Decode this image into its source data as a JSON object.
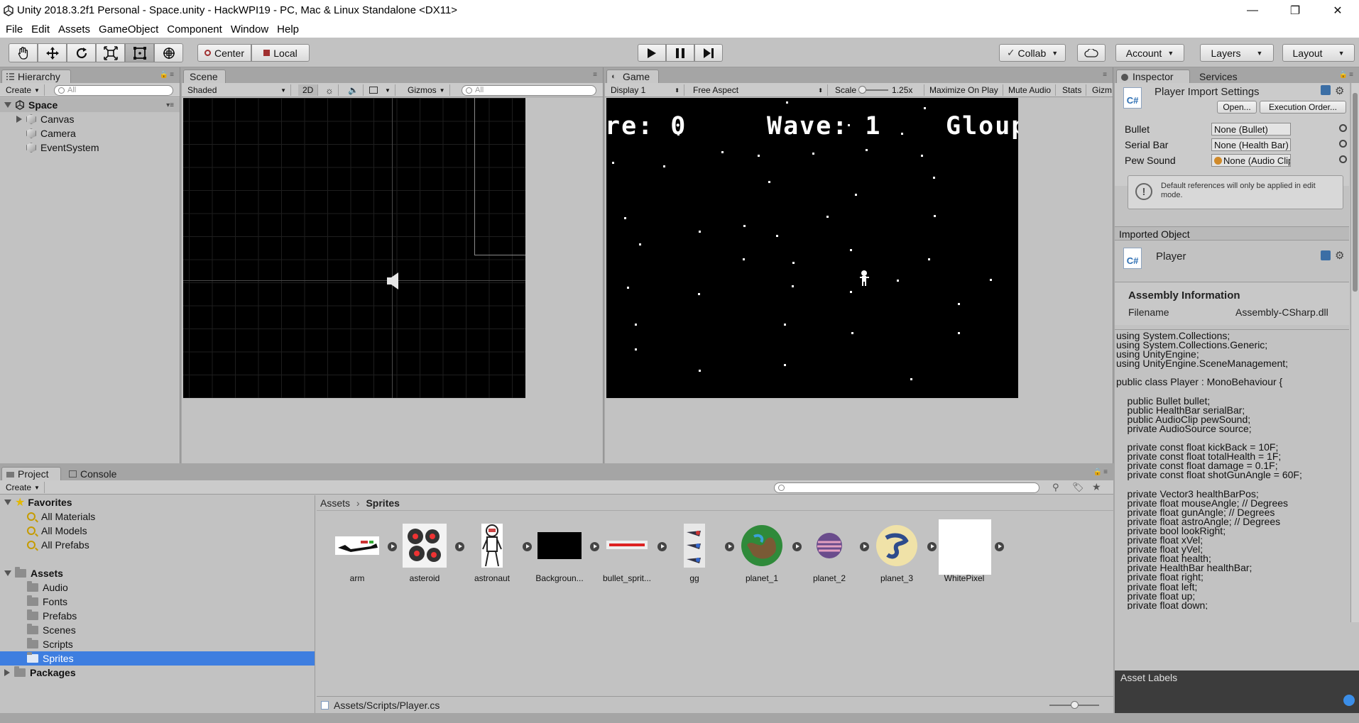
{
  "window": {
    "title": "Unity 2018.3.2f1 Personal - Space.unity - HackWPI19 - PC, Mac & Linux Standalone <DX11>",
    "controls": [
      "—",
      "❐",
      "✕"
    ]
  },
  "menu": [
    "File",
    "Edit",
    "Assets",
    "GameObject",
    "Component",
    "Window",
    "Help"
  ],
  "toolbar": {
    "tools": [
      "hand-tool",
      "move-tool",
      "rotate-tool",
      "scale-tool",
      "rect-tool",
      "transform-tool"
    ],
    "pivot": "Center",
    "space": "Local",
    "collab": "Collab",
    "account": "Account",
    "layers": "Layers",
    "layout": "Layout"
  },
  "hierarchy": {
    "tab": "Hierarchy",
    "create": "Create",
    "search_placeholder": "All",
    "scene": "Space",
    "objects": [
      "Canvas",
      "Camera",
      "EventSystem"
    ]
  },
  "scene": {
    "tab": "Scene",
    "shading": "Shaded",
    "mode_2d": "2D",
    "gizmos": "Gizmos",
    "search_placeholder": "All"
  },
  "game": {
    "tab": "Game",
    "display": "Display 1",
    "aspect": "Free Aspect",
    "scale_label": "Scale",
    "scale_value": "1.25x",
    "maximize": "Maximize On Play",
    "mute": "Mute Audio",
    "stats": "Stats",
    "gizmos": "Gizm",
    "hud_score": "re: 0",
    "hud_wave": "Wave: 1",
    "hud_gloups": "Gloups Left"
  },
  "inspector": {
    "tab": "Inspector",
    "services_tab": "Services",
    "header": "Player Import Settings",
    "open": "Open...",
    "execution_order": "Execution Order...",
    "fields": [
      {
        "label": "Bullet",
        "value": "None (Bullet)"
      },
      {
        "label": "Serial Bar",
        "value": "None (Health Bar)"
      },
      {
        "label": "Pew Sound",
        "value": "None (Audio Clip)"
      }
    ],
    "info": "Default references will only be applied in edit mode.",
    "imported_object": "Imported Object",
    "object_name": "Player",
    "assembly_header": "Assembly Information",
    "filename_label": "Filename",
    "filename_value": "Assembly-CSharp.dll",
    "code": "using System.Collections;\nusing System.Collections.Generic;\nusing UnityEngine;\nusing UnityEngine.SceneManagement;\n\npublic class Player : MonoBehaviour {\n\n    public Bullet bullet;\n    public HealthBar serialBar;\n    public AudioClip pewSound;\n    private AudioSource source;\n\n    private const float kickBack = 10F;\n    private const float totalHealth = 1F;\n    private const float damage = 0.1F;\n    private const float shotGunAngle = 60F;\n\n    private Vector3 healthBarPos;\n    private float mouseAngle; // Degrees\n    private float gunAngle; // Degrees\n    private float astroAngle; // Degrees\n    private bool lookRight;\n    private float xVel;\n    private float yVel;\n    private float health;\n    private HealthBar healthBar;\n    private float right;\n    private float left;\n    private float up;\n    private float down;",
    "asset_labels": "Asset Labels"
  },
  "project": {
    "tab": "Project",
    "console_tab": "Console",
    "create": "Create",
    "favorites_label": "Favorites",
    "favorites": [
      "All Materials",
      "All Models",
      "All Prefabs"
    ],
    "assets_label": "Assets",
    "asset_folders": [
      "Audio",
      "Fonts",
      "Prefabs",
      "Scenes",
      "Scripts",
      "Sprites"
    ],
    "packages_label": "Packages",
    "breadcrumb_root": "Assets",
    "breadcrumb_current": "Sprites",
    "items": [
      "arm",
      "asteroid",
      "astronaut",
      "Backgroun...",
      "bullet_sprit...",
      "gg",
      "planet_1",
      "planet_2",
      "planet_3",
      "WhitePixel"
    ],
    "status_path": "Assets/Scripts/Player.cs"
  },
  "colors": {
    "selection": "#3e7ee0",
    "panel_bg": "#c2c2c2",
    "toolbar_bg": "#c2c2c2"
  }
}
